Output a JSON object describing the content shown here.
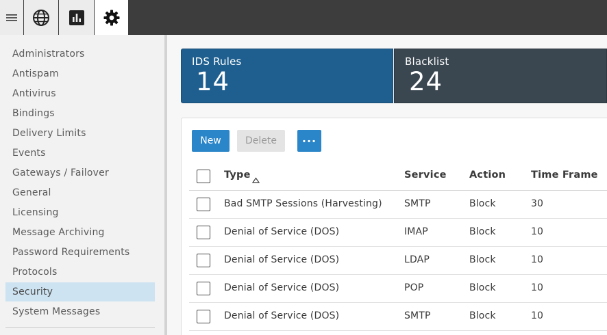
{
  "toolbar": {
    "icons": [
      "hamburger-menu-icon",
      "globe-icon",
      "bar-chart-icon",
      "gear-icon"
    ]
  },
  "sidebar": {
    "items": [
      {
        "label": "Administrators"
      },
      {
        "label": "Antispam"
      },
      {
        "label": "Antivirus"
      },
      {
        "label": "Bindings"
      },
      {
        "label": "Delivery Limits"
      },
      {
        "label": "Events"
      },
      {
        "label": "Gateways / Failover"
      },
      {
        "label": "General"
      },
      {
        "label": "Licensing"
      },
      {
        "label": "Message Archiving"
      },
      {
        "label": "Password Requirements"
      },
      {
        "label": "Protocols"
      },
      {
        "label": "Security",
        "active": true
      },
      {
        "label": "System Messages"
      }
    ]
  },
  "summary": {
    "ids_rules": {
      "label": "IDS Rules",
      "value": "14"
    },
    "blacklist": {
      "label": "Blacklist",
      "value": "24"
    }
  },
  "actions": {
    "new_label": "New",
    "delete_label": "Delete",
    "more_label": "···"
  },
  "table": {
    "headers": {
      "type": "Type",
      "service": "Service",
      "action": "Action",
      "time_frame": "Time Frame"
    },
    "sort": {
      "column": "type",
      "direction": "ascending"
    },
    "rows": [
      {
        "type": "Bad SMTP Sessions (Harvesting)",
        "service": "SMTP",
        "action": "Block",
        "time_frame": "30"
      },
      {
        "type": "Denial of Service (DOS)",
        "service": "IMAP",
        "action": "Block",
        "time_frame": "10"
      },
      {
        "type": "Denial of Service (DOS)",
        "service": "LDAP",
        "action": "Block",
        "time_frame": "10"
      },
      {
        "type": "Denial of Service (DOS)",
        "service": "POP",
        "action": "Block",
        "time_frame": "10"
      },
      {
        "type": "Denial of Service (DOS)",
        "service": "SMTP",
        "action": "Block",
        "time_frame": "10"
      }
    ]
  },
  "colors": {
    "ids_card": "#1f5f8f",
    "blacklist_card": "#3a4650",
    "primary_button": "#2a85c9",
    "active_nav": "#cde3f1",
    "topbar": "#3d3d3d"
  }
}
